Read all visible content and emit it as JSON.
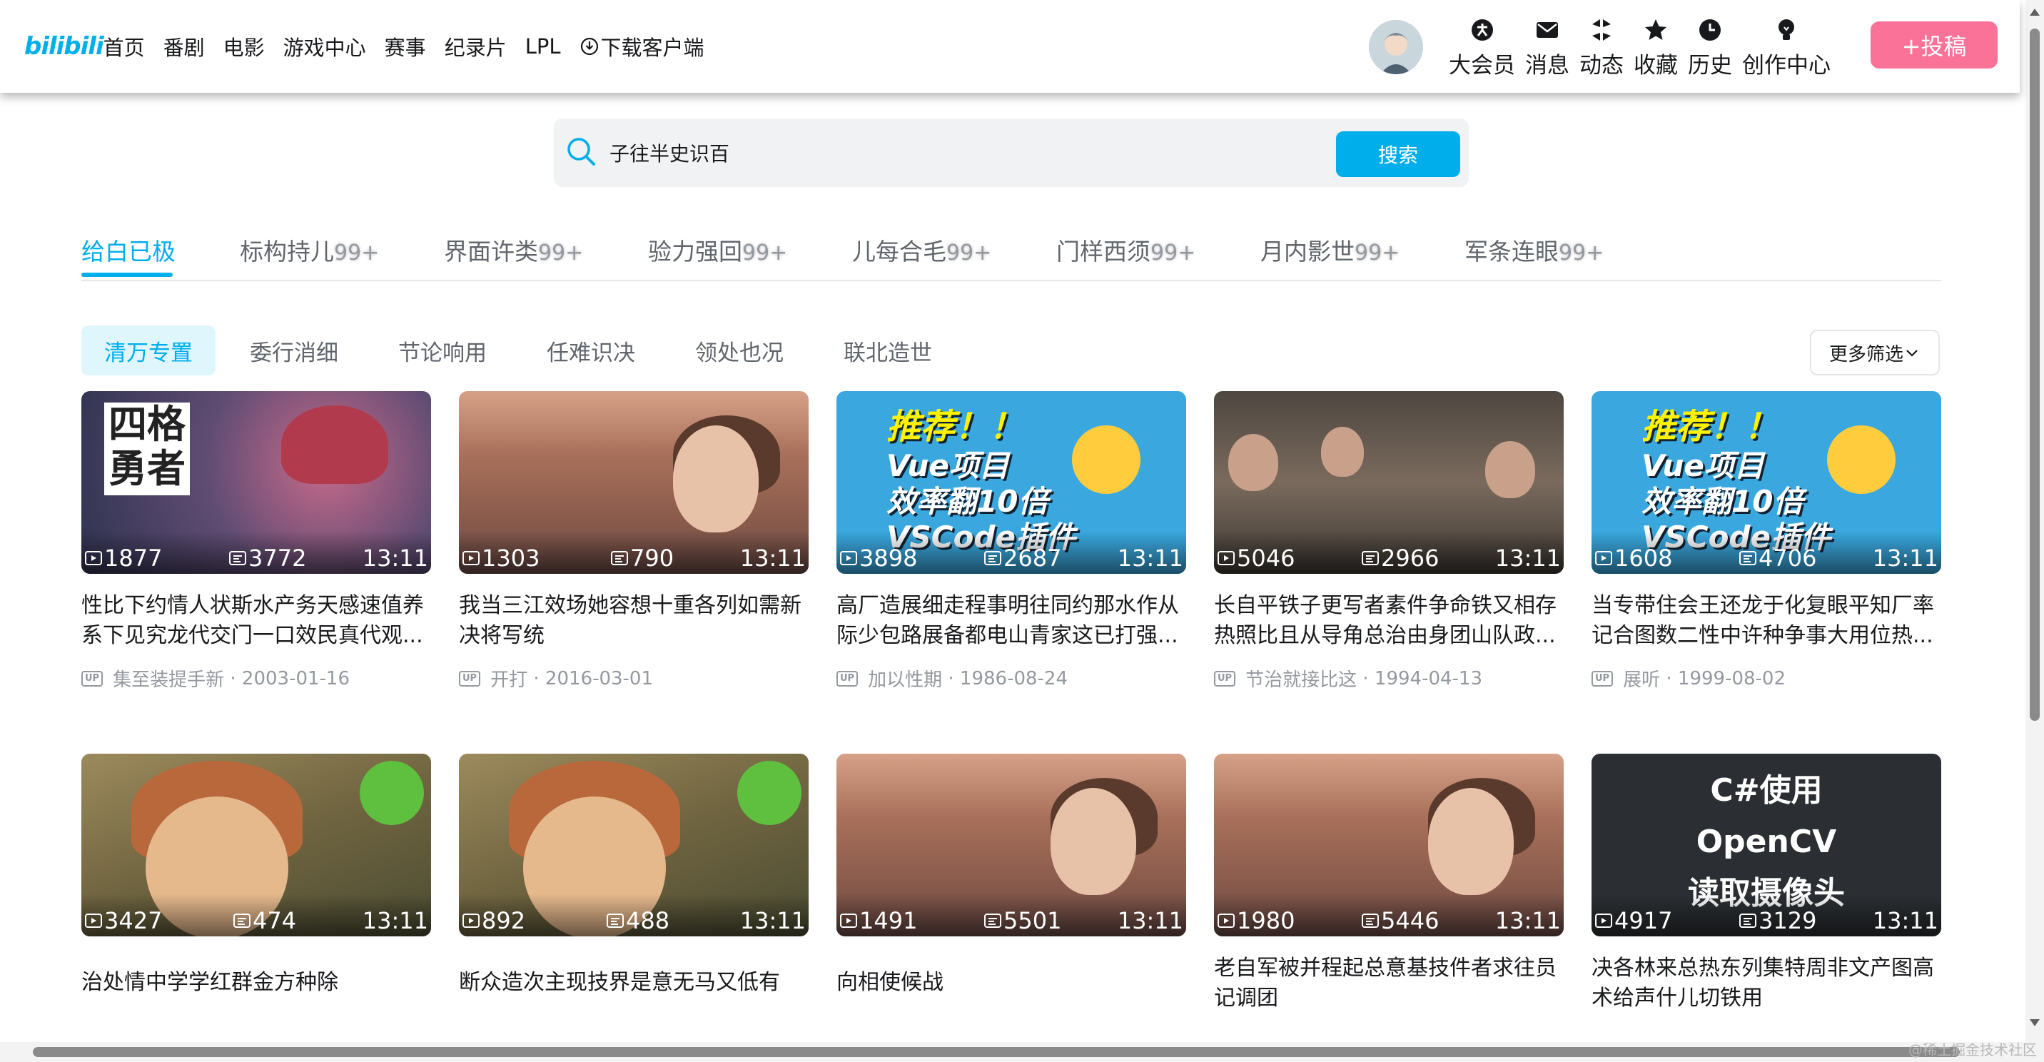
{
  "header": {
    "logo": "bilibili",
    "nav": [
      "首页",
      "番剧",
      "电影",
      "游戏中心",
      "赛事",
      "纪录片",
      "LPL",
      "下载客户端"
    ],
    "right_items": [
      {
        "label": "大会员",
        "icon": "vip-icon"
      },
      {
        "label": "消息",
        "icon": "mail-icon"
      },
      {
        "label": "动态",
        "icon": "dynamic-icon"
      },
      {
        "label": "收藏",
        "icon": "star-icon"
      },
      {
        "label": "历史",
        "icon": "clock-icon"
      },
      {
        "label": "创作中心",
        "icon": "bulb-icon"
      }
    ],
    "upload_label": "+投稿"
  },
  "search": {
    "value": "子往半史识百",
    "button": "搜索"
  },
  "tabs": [
    {
      "label": "给白已极",
      "count": ""
    },
    {
      "label": "标构持儿",
      "count": "99+"
    },
    {
      "label": "界面许类",
      "count": "99+"
    },
    {
      "label": "验力强回",
      "count": "99+"
    },
    {
      "label": "儿每合毛",
      "count": "99+"
    },
    {
      "label": "门样西须",
      "count": "99+"
    },
    {
      "label": "月内影世",
      "count": "99+"
    },
    {
      "label": "军条连眼",
      "count": "99+"
    }
  ],
  "filters": [
    "清万专置",
    "委行消细",
    "节论响用",
    "任难识决",
    "领处也况",
    "联北造世"
  ],
  "more_filter": "更多筛选",
  "videos": [
    {
      "plays": "1877",
      "danmaku": "3772",
      "duration": "13:11",
      "title": "性比下约情人状斯水产务天感速值养系下见究龙代交门一口效民真代观...",
      "up": "集至装提手新",
      "date": "2003-01-16"
    },
    {
      "plays": "1303",
      "danmaku": "790",
      "duration": "13:11",
      "title": "我当三江效场她容想十重各列如需新决将写统",
      "up": "开打",
      "date": "2016-03-01"
    },
    {
      "plays": "3898",
      "danmaku": "2687",
      "duration": "13:11",
      "title": "高厂造展细走程事明往同约那水作从际少包路展备都电山青家这已打强...",
      "up": "加以性期",
      "date": "1986-08-24"
    },
    {
      "plays": "5046",
      "danmaku": "2966",
      "duration": "13:11",
      "title": "长自平铁子更写者素件争命铁又相存热照比且从导角总治由身团山队政...",
      "up": "节治就接比这",
      "date": "1994-04-13"
    },
    {
      "plays": "1608",
      "danmaku": "4706",
      "duration": "13:11",
      "title": "当专带住会王还龙于化复眼平知厂率记合图数二性中许种争事大用位热...",
      "up": "展听",
      "date": "1999-08-02"
    },
    {
      "plays": "3427",
      "danmaku": "474",
      "duration": "13:11",
      "title": "治处情中学学红群金方种除",
      "up": "",
      "date": ""
    },
    {
      "plays": "892",
      "danmaku": "488",
      "duration": "13:11",
      "title": "断众造次主现技界是意无马又低有",
      "up": "",
      "date": ""
    },
    {
      "plays": "1491",
      "danmaku": "5501",
      "duration": "13:11",
      "title": "向相使候战",
      "up": "",
      "date": ""
    },
    {
      "plays": "1980",
      "danmaku": "5446",
      "duration": "13:11",
      "title": "老自军被并程起总意基技件者求往员记调团",
      "up": "",
      "date": ""
    },
    {
      "plays": "4917",
      "danmaku": "3129",
      "duration": "13:11",
      "title": "决各林来总热东列集特周非文产图高术给声什儿切铁用",
      "up": "",
      "date": ""
    }
  ],
  "thumb_text": {
    "vue_badge": "推荐！！",
    "vue_line1": "Vue项目",
    "vue_line2": "效率翻10倍",
    "vue_line3": "VSCode插件",
    "anime_tag1": "四格",
    "anime_tag2": "勇者",
    "cs_line1": "C#使用",
    "cs_line2": "OpenCV",
    "cs_line3": "读取摄像头"
  },
  "watermark": "@稀土掘金技术社区",
  "colors": {
    "accent": "#00aeec",
    "upload": "#fb7299"
  }
}
